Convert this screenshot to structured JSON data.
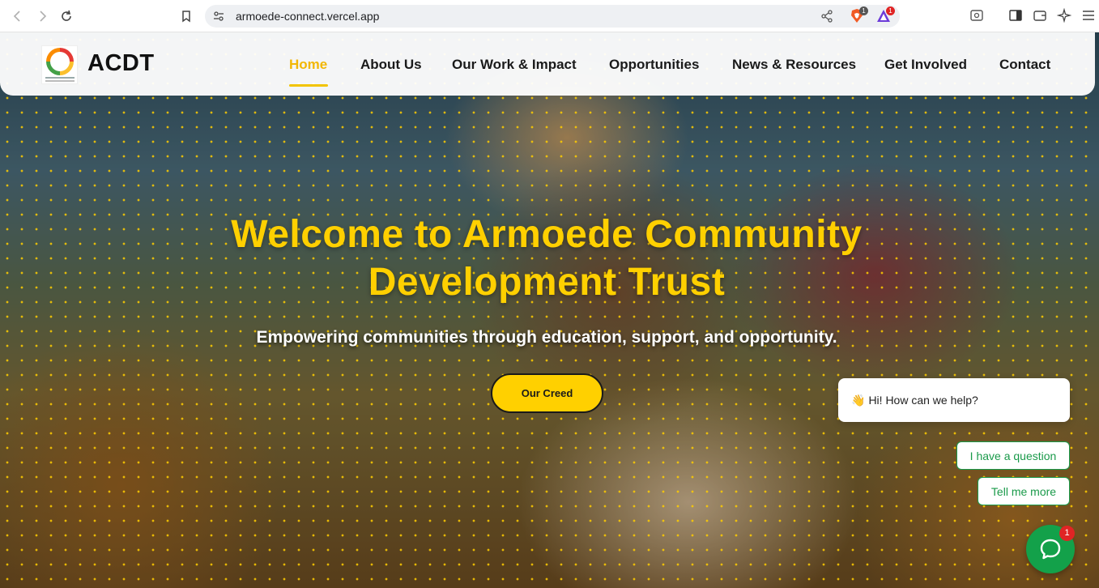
{
  "browser": {
    "url": "armoede-connect.vercel.app",
    "brave_badge": "1",
    "rewards_badge": "1"
  },
  "header": {
    "brand": "ACDT",
    "nav": [
      {
        "label": "Home",
        "active": true
      },
      {
        "label": "About Us"
      },
      {
        "label": "Our Work & Impact"
      },
      {
        "label": "Opportunities"
      },
      {
        "label": "News & Resources"
      },
      {
        "label": "Get Involved"
      },
      {
        "label": "Contact"
      }
    ]
  },
  "hero": {
    "title_line1": "Welcome to Armoede Community",
    "title_line2": "Development Trust",
    "subtitle": "Empowering communities through education, support, and opportunity.",
    "cta": "Our Creed"
  },
  "chat": {
    "greeting_emoji": "👋",
    "greeting": "Hi! How can we help?",
    "options": [
      "I have a question",
      "Tell me more"
    ],
    "unread": "1"
  },
  "colors": {
    "accent": "#ffd000",
    "chat_green": "#13a14a",
    "badge_red": "#e02424"
  }
}
